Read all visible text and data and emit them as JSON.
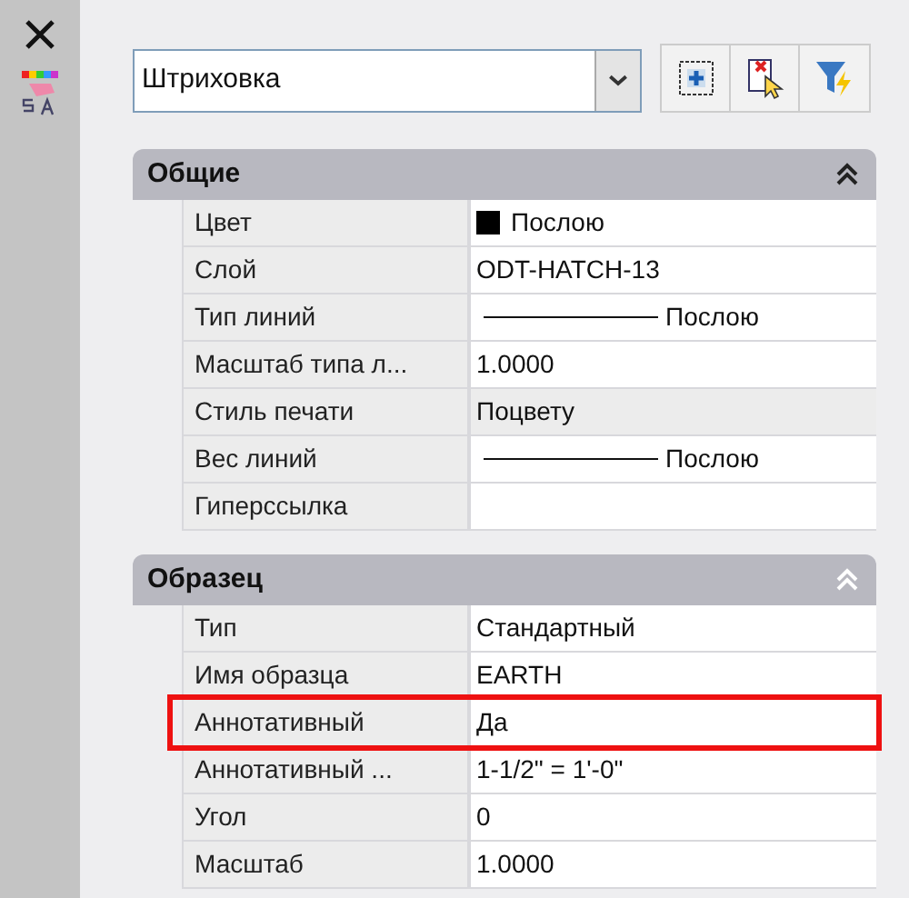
{
  "object_selector": {
    "value": "Штриховка"
  },
  "sections": [
    {
      "title": "Общие",
      "expanded": true,
      "rows": [
        {
          "label": "Цвет",
          "value": "Послою",
          "kind": "color",
          "color": "#000000",
          "disabled": false,
          "highlighted": false
        },
        {
          "label": "Слой",
          "value": "ODT-HATCH-13",
          "kind": "text",
          "disabled": false,
          "highlighted": false
        },
        {
          "label": "Тип линий",
          "value": "Послою",
          "kind": "line",
          "disabled": false,
          "highlighted": false
        },
        {
          "label": "Масштаб типа л...",
          "value": "1.0000",
          "kind": "text",
          "disabled": false,
          "highlighted": false
        },
        {
          "label": "Стиль печати",
          "value": "Поцвету",
          "kind": "text",
          "disabled": true,
          "highlighted": false
        },
        {
          "label": "Вес линий",
          "value": "Послою",
          "kind": "line",
          "disabled": false,
          "highlighted": false
        },
        {
          "label": "Гиперссылка",
          "kind": "text",
          "disabled": false,
          "highlighted": false
        }
      ]
    },
    {
      "title": "Образец",
      "expanded": true,
      "rows": [
        {
          "label": "Тип",
          "value": "Стандартный",
          "kind": "text",
          "disabled": false,
          "highlighted": false
        },
        {
          "label": "Имя образца",
          "value": "EARTH",
          "kind": "text",
          "disabled": false,
          "highlighted": false
        },
        {
          "label": "Аннотативный",
          "value": "Да",
          "kind": "text",
          "disabled": false,
          "highlighted": true
        },
        {
          "label": "Аннотативный ...",
          "value": "1-1/2\" = 1'-0\"",
          "kind": "text",
          "disabled": false,
          "highlighted": false
        },
        {
          "label": "Угол",
          "value": "0",
          "kind": "text",
          "disabled": false,
          "highlighted": false
        },
        {
          "label": "Масштаб",
          "value": "1.0000",
          "kind": "text",
          "disabled": false,
          "highlighted": false
        }
      ]
    }
  ]
}
